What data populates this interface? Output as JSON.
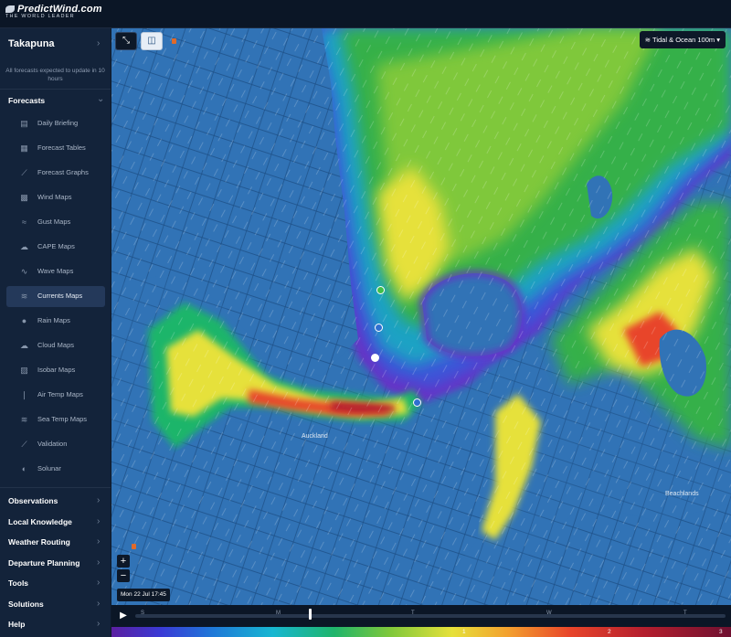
{
  "app": {
    "brand": "PredictWind.com",
    "tagline": "THE WORLD LEADER"
  },
  "sidebar": {
    "location": "Takapuna",
    "update_notice": "All forecasts expected to update in 10 hours",
    "forecasts_header": "Forecasts",
    "items": [
      {
        "label": "Daily Briefing",
        "icon": "book-icon"
      },
      {
        "label": "Forecast Tables",
        "icon": "table-icon"
      },
      {
        "label": "Forecast Graphs",
        "icon": "graph-icon"
      },
      {
        "label": "Wind Maps",
        "icon": "wind-icon"
      },
      {
        "label": "Gust Maps",
        "icon": "gust-icon"
      },
      {
        "label": "CAPE Maps",
        "icon": "storm-cloud-icon"
      },
      {
        "label": "Wave Maps",
        "icon": "wave-icon"
      },
      {
        "label": "Currents Maps",
        "icon": "currents-icon"
      },
      {
        "label": "Rain Maps",
        "icon": "rain-drop-icon"
      },
      {
        "label": "Cloud Maps",
        "icon": "cloud-icon"
      },
      {
        "label": "Isobar Maps",
        "icon": "isobar-icon"
      },
      {
        "label": "Air Temp Maps",
        "icon": "thermometer-icon"
      },
      {
        "label": "Sea Temp Maps",
        "icon": "sea-temp-icon"
      },
      {
        "label": "Validation",
        "icon": "validation-icon"
      },
      {
        "label": "Solunar",
        "icon": "moon-icon"
      }
    ],
    "active_item": "Currents Maps",
    "sections": [
      "Observations",
      "Local Knowledge",
      "Weather Routing",
      "Departure Planning",
      "Tools",
      "Solutions",
      "Help"
    ]
  },
  "map": {
    "layer_selector": "Tidal & Ocean 100m",
    "date_time": "Mon 22 Jul 17:45",
    "zoom_in": "+",
    "zoom_out": "−",
    "places": [
      "Auckland",
      "Beachlands"
    ],
    "timeline_days": [
      "S",
      "M",
      "T",
      "W",
      "T"
    ],
    "scale_labels": [
      "1",
      "2",
      "3"
    ]
  }
}
